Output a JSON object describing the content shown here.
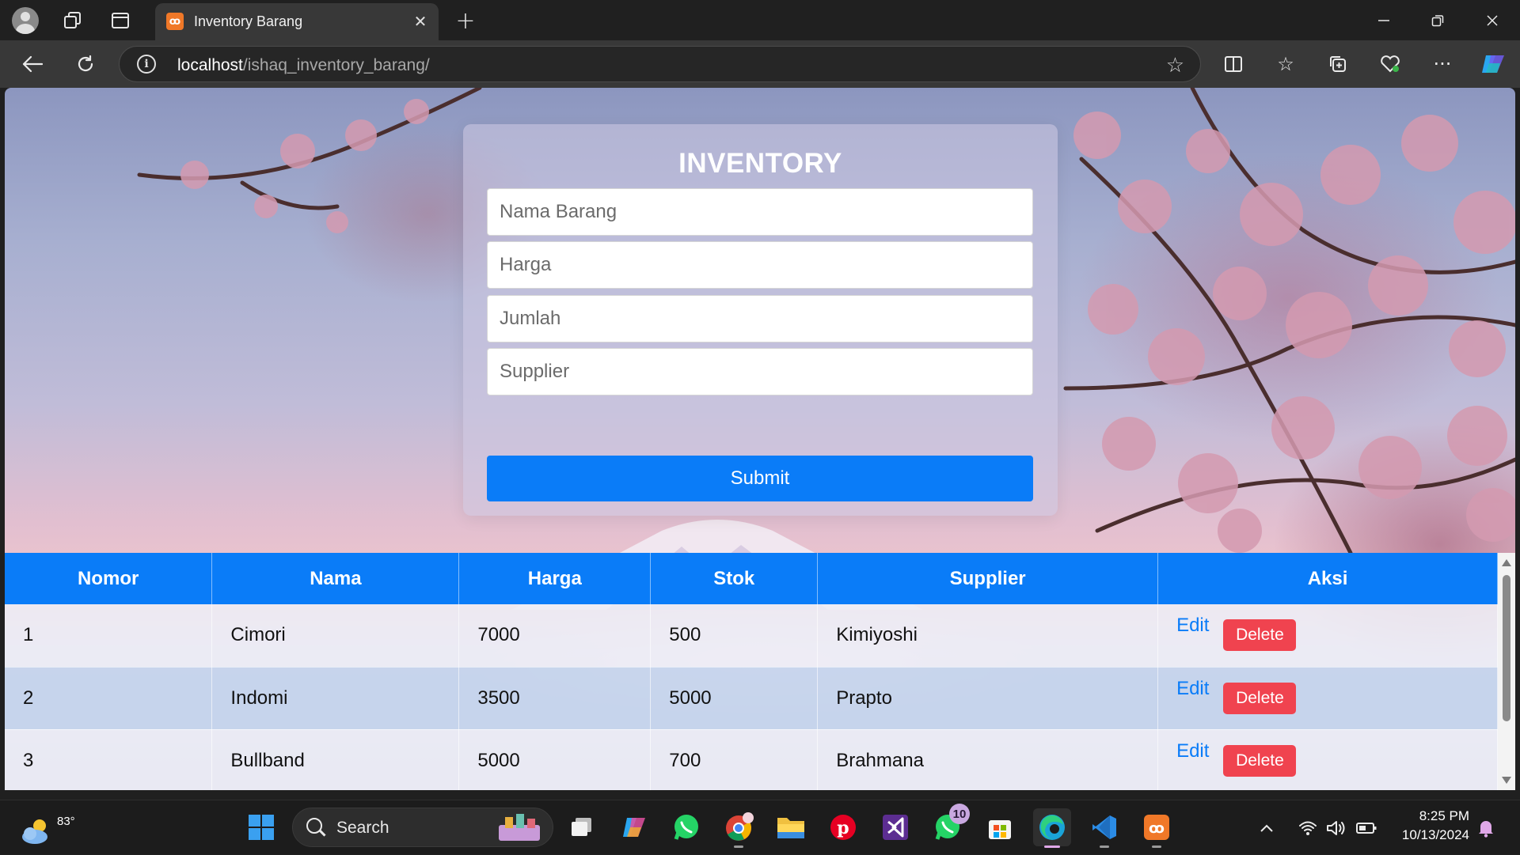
{
  "browser": {
    "tab_title": "Inventory Barang",
    "tab_favicon_text": "ꝏ",
    "url_host": "localhost",
    "url_path": "/ishaq_inventory_barang/"
  },
  "form": {
    "title": "INVENTORY",
    "nama_placeholder": "Nama Barang",
    "harga_placeholder": "Harga",
    "jumlah_placeholder": "Jumlah",
    "supplier_placeholder": "Supplier",
    "submit_label": "Submit"
  },
  "table": {
    "headers": [
      "Nomor",
      "Nama",
      "Harga",
      "Stok",
      "Supplier",
      "Aksi"
    ],
    "rows": [
      {
        "nomor": "1",
        "nama": "Cimori",
        "harga": "7000",
        "stok": "500",
        "supplier": "Kimiyoshi",
        "edit": "Edit",
        "delete": "Delete"
      },
      {
        "nomor": "2",
        "nama": "Indomi",
        "harga": "3500",
        "stok": "5000",
        "supplier": "Prapto",
        "edit": "Edit",
        "delete": "Delete"
      },
      {
        "nomor": "3",
        "nama": "Bullband",
        "harga": "5000",
        "stok": "700",
        "supplier": "Brahmana",
        "edit": "Edit",
        "delete": "Delete"
      }
    ]
  },
  "taskbar": {
    "weather_temp": "83°",
    "search_label": "Search",
    "whatsapp_badge": "10",
    "time": "8:25 PM",
    "date": "10/13/2024"
  },
  "colors": {
    "primary": "#0a7cf8",
    "danger": "#f0434f",
    "browser_chrome": "#202020",
    "toolbar": "#383838"
  },
  "icons": [
    "profile-icon",
    "workspaces-icon",
    "tab-actions-icon",
    "xampp-favicon-icon",
    "close-tab-icon",
    "new-tab-icon",
    "minimize-icon",
    "restore-icon",
    "close-window-icon",
    "back-icon",
    "refresh-icon",
    "site-info-icon",
    "favorite-star-icon",
    "split-screen-icon",
    "favorites-icon",
    "collections-icon",
    "browser-essentials-icon",
    "more-icon",
    "copilot-icon",
    "weather-icon",
    "windows-start-icon",
    "search-icon",
    "task-view-icon",
    "copilot-app-icon",
    "whatsapp-icon",
    "chrome-icon",
    "file-explorer-icon",
    "pinterest-icon",
    "visual-studio-icon",
    "whatsapp-beta-icon",
    "microsoft-store-icon",
    "edge-icon",
    "vscode-icon",
    "xampp-icon",
    "tray-chevron-icon",
    "wifi-icon",
    "volume-icon",
    "battery-icon",
    "notification-bell-icon"
  ]
}
